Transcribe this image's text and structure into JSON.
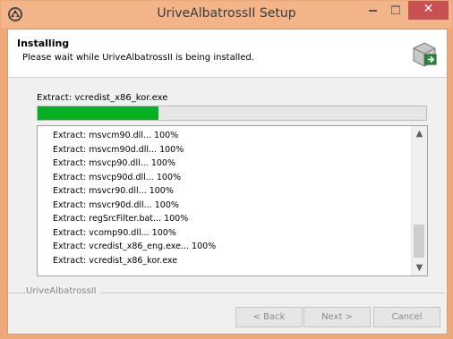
{
  "window": {
    "title": "UriveAlbatrossII Setup"
  },
  "header": {
    "title": "Installing",
    "subtitle": "Please wait while UriveAlbatrossII is being installed."
  },
  "progress": {
    "label": "Extract: vcredist_x86_kor.exe",
    "value": 0.31
  },
  "log": {
    "lines": [
      "Extract: msvcm90.dll... 100%",
      "Extract: msvcm90d.dll... 100%",
      "Extract: msvcp90.dll... 100%",
      "Extract: msvcp90d.dll... 100%",
      "Extract: msvcr90.dll... 100%",
      "Extract: msvcr90d.dll... 100%",
      "Extract: regSrcFilter.bat... 100%",
      "Extract: vcomp90.dll... 100%",
      "Extract: vcredist_x86_eng.exe... 100%",
      "Extract: vcredist_x86_kor.exe"
    ]
  },
  "footer": {
    "brand": "UriveAlbatrossII",
    "back_label": "< Back",
    "next_label": "Next >",
    "cancel_label": "Cancel"
  },
  "colors": {
    "progress_fill": "#06b025",
    "titlebar": "#f4b48a",
    "close_button": "#c75050"
  },
  "icons": {
    "app": "installer-icon",
    "header": "setup-box-icon",
    "minimize": "minimize-icon",
    "maximize": "maximize-icon",
    "close": "close-icon",
    "scroll_up": "scroll-up-arrow-icon",
    "scroll_down": "scroll-down-arrow-icon"
  }
}
